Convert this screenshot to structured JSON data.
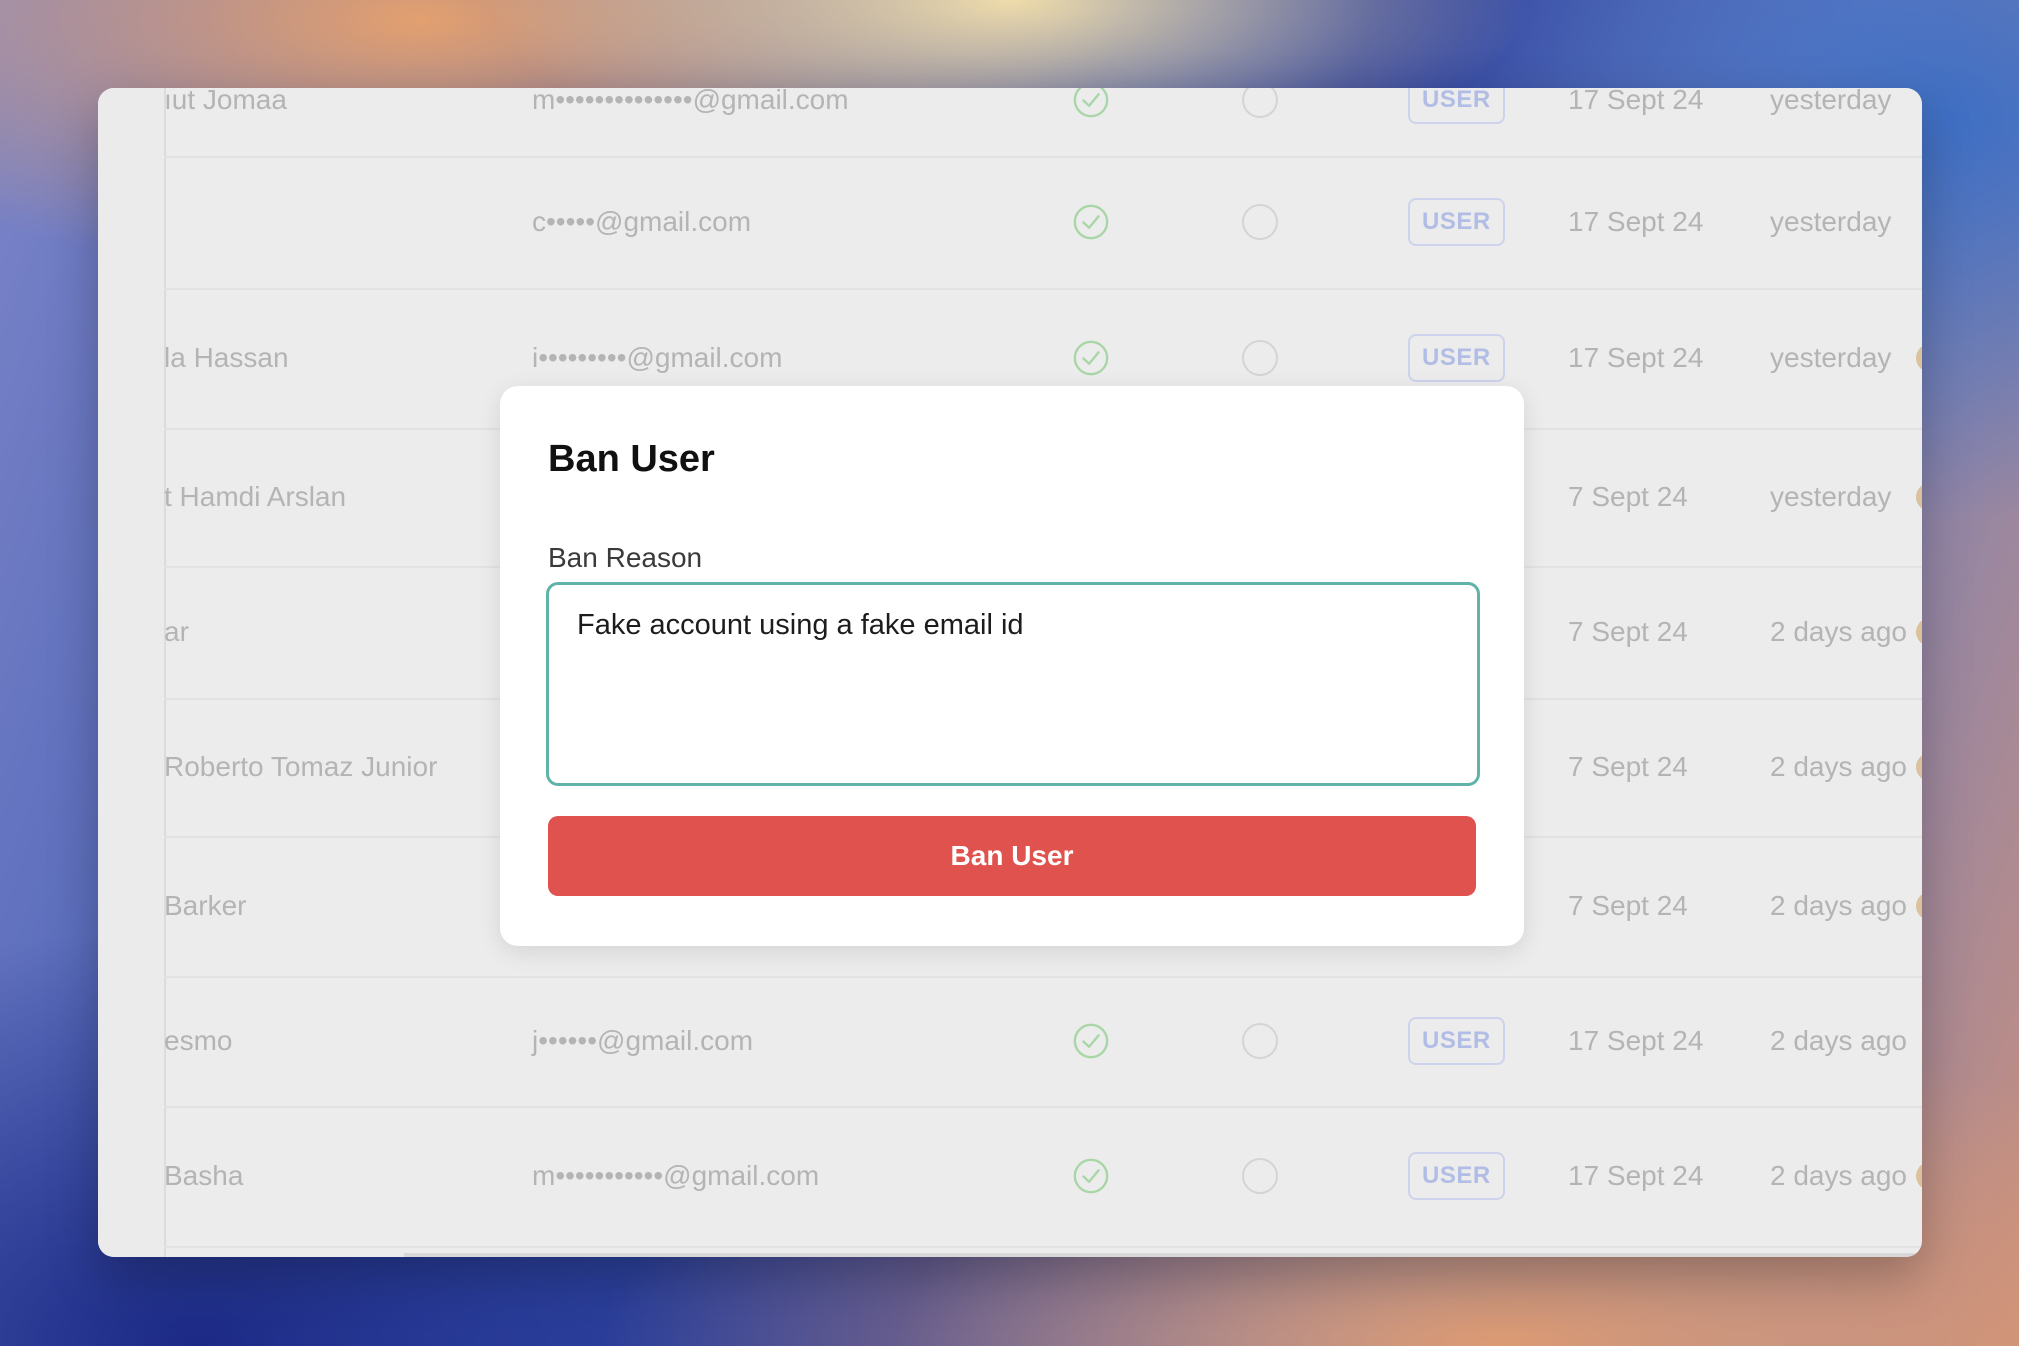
{
  "colors": {
    "accent_teal": "#5fb3a8",
    "danger_red": "#df524d",
    "role_badge_text": "#b2bde6"
  },
  "table": {
    "rows": [
      {
        "name": "ıut Jomaa",
        "email": "m••••••••••••••@gmail.com",
        "verified": true,
        "role": "USER",
        "joined": "17 Sept 24",
        "last_seen": "yesterday"
      },
      {
        "name": "",
        "email": "c•••••@gmail.com",
        "verified": true,
        "role": "USER",
        "joined": "17 Sept 24",
        "last_seen": "yesterday"
      },
      {
        "name": "la Hassan",
        "email": "i•••••••••@gmail.com",
        "verified": true,
        "role": "USER",
        "joined": "17 Sept 24",
        "last_seen": "yesterday"
      },
      {
        "name": "t Hamdi Arslan",
        "email": "",
        "verified": null,
        "role": "",
        "joined": "7 Sept 24",
        "last_seen": "yesterday"
      },
      {
        "name": "ar",
        "email": "",
        "verified": null,
        "role": "",
        "joined": "7 Sept 24",
        "last_seen": "2 days ago"
      },
      {
        "name": "Roberto Tomaz Junior",
        "email": "",
        "verified": null,
        "role": "",
        "joined": "7 Sept 24",
        "last_seen": "2 days ago"
      },
      {
        "name": "Barker",
        "email": "",
        "verified": null,
        "role": "",
        "joined": "7 Sept 24",
        "last_seen": "2 days ago"
      },
      {
        "name": "esmo",
        "email": "j••••••@gmail.com",
        "verified": true,
        "role": "USER",
        "joined": "17 Sept 24",
        "last_seen": "2 days ago"
      },
      {
        "name": "Basha",
        "email": "m•••••••••••@gmail.com",
        "verified": true,
        "role": "USER",
        "joined": "17 Sept 24",
        "last_seen": "2 days ago"
      }
    ]
  },
  "modal": {
    "title": "Ban User",
    "reason_label": "Ban Reason",
    "reason_value": "Fake account using a fake email id",
    "submit_label": "Ban User"
  }
}
